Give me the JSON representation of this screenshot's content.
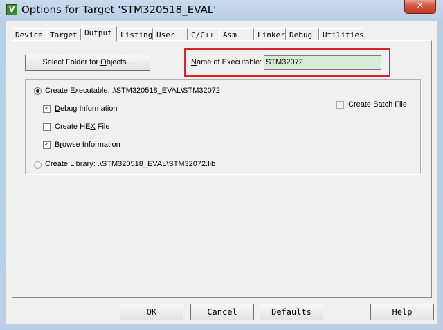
{
  "window": {
    "title": "Options for Target 'STM320518_EVAL'",
    "close_glyph": "✕",
    "app_icon_glyph": "V"
  },
  "tabs": [
    {
      "label": "Device"
    },
    {
      "label": "Target"
    },
    {
      "label": "Output",
      "active": true
    },
    {
      "label": "Listing"
    },
    {
      "label": "User"
    },
    {
      "label": "C/C++"
    },
    {
      "label": "Asm"
    },
    {
      "label": "Linker"
    },
    {
      "label": "Debug"
    },
    {
      "label": "Utilities"
    }
  ],
  "output": {
    "select_folder": {
      "pre": "Select Folder for ",
      "ul": "O",
      "post": "bjects..."
    },
    "name_label": {
      "ul": "N",
      "rest": "ame of Executable:"
    },
    "name_value": "STM32072",
    "create_exe": {
      "text": "Create Executable:  .\\STM320518_EVAL\\STM32072",
      "selected": true
    },
    "debug_info": {
      "ul": "D",
      "rest": "ebug Information",
      "checked": true
    },
    "create_hex": {
      "pre": "Create HE",
      "ul": "X",
      "post": " File",
      "checked": false
    },
    "browse_info": {
      "pre": "B",
      "ul": "r",
      "post": "owse Information",
      "checked": true
    },
    "create_batch": {
      "text": "Create Batch File",
      "checked": false
    },
    "create_lib": {
      "text": "Create Library:  .\\STM320518_EVAL\\STM32072.lib",
      "selected": false
    }
  },
  "buttons": {
    "ok": "OK",
    "cancel": "Cancel",
    "defaults": "Defaults",
    "help": "Help"
  },
  "colors": {
    "highlight": "#d8232a",
    "input_bg": "#d6ecd4"
  }
}
